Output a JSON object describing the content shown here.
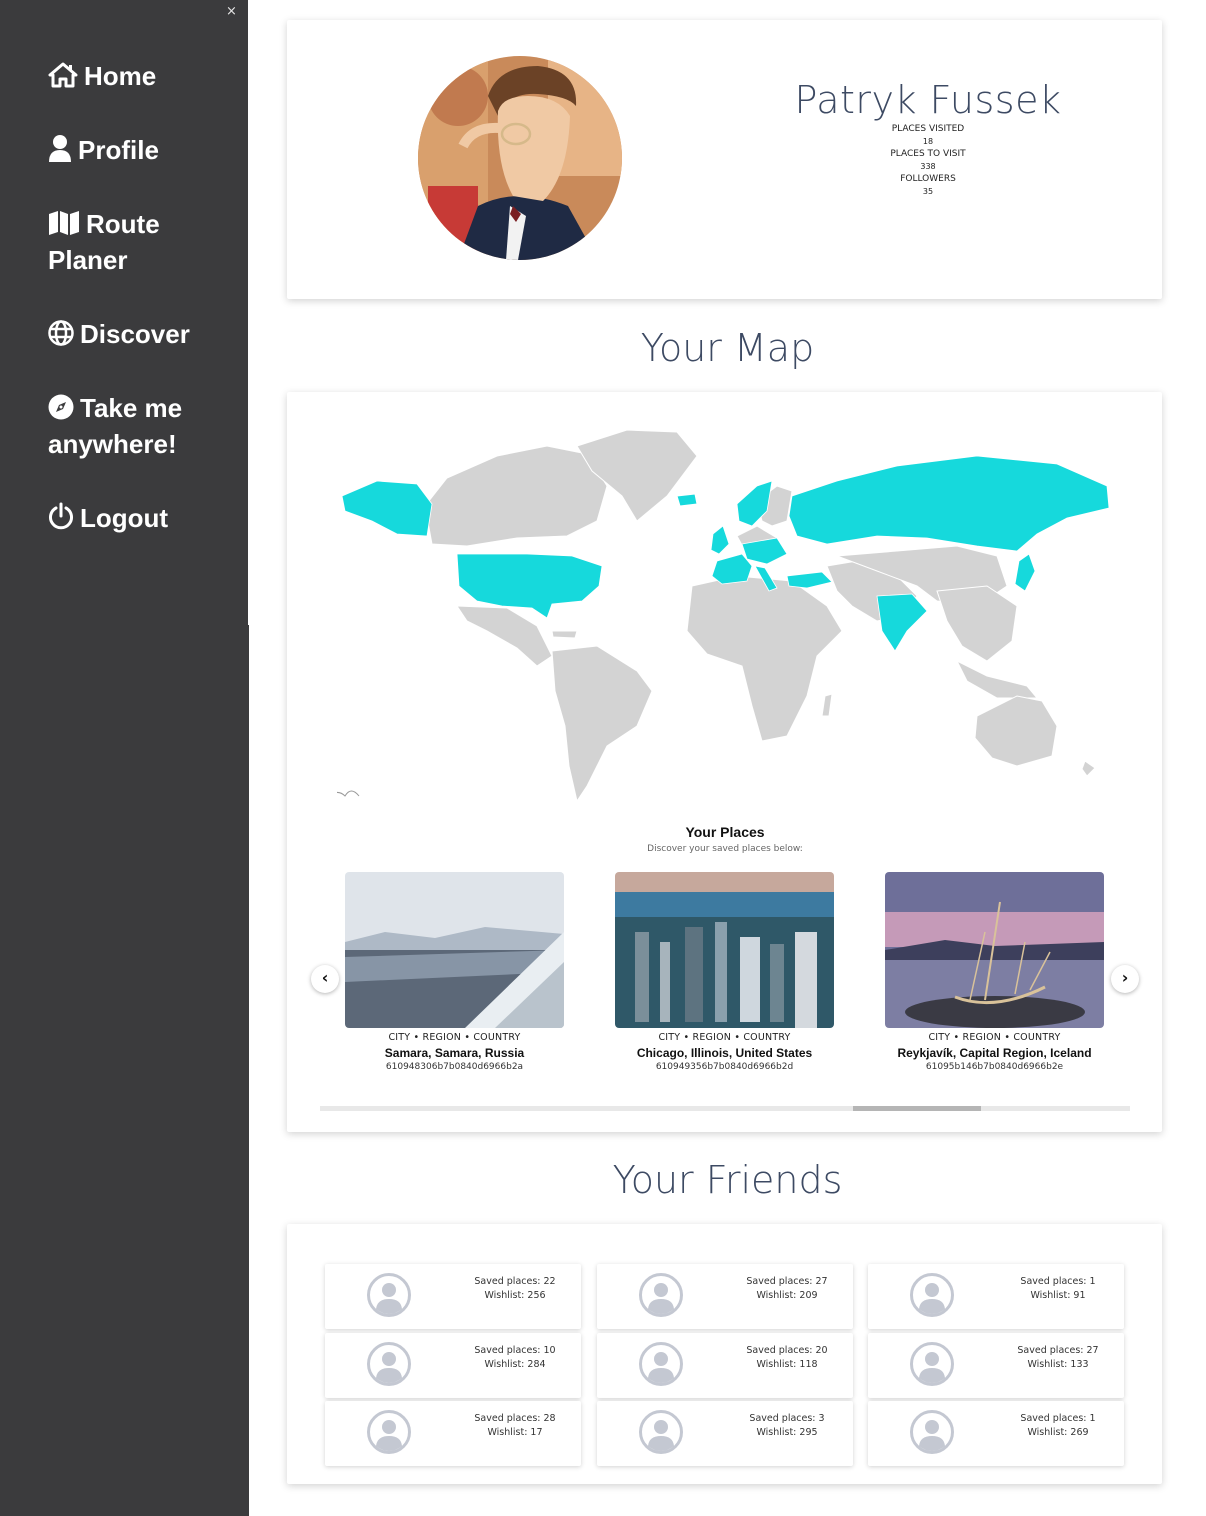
{
  "sidebar": {
    "close_label": "×",
    "items": [
      {
        "label": "Home",
        "icon": "home-icon"
      },
      {
        "label": "Profile",
        "icon": "user-icon"
      },
      {
        "label": "Route Planer",
        "icon": "map-icon"
      },
      {
        "label": "Discover",
        "icon": "globe-icon"
      },
      {
        "label": "Take me anywhere!",
        "icon": "compass-icon"
      },
      {
        "label": "Logout",
        "icon": "power-icon"
      }
    ]
  },
  "profile": {
    "name": "Patryk Fussek",
    "stats": [
      {
        "label": "PLACES VISITED",
        "value": "18"
      },
      {
        "label": "PLACES TO VISIT",
        "value": "338"
      },
      {
        "label": "FOLLOWERS",
        "value": "35"
      }
    ]
  },
  "map_section": {
    "title": "Your Map",
    "visited_color": "#16d9dc",
    "other_color": "#d3d3d3",
    "visited_regions": [
      "Alaska",
      "United States",
      "United Kingdom",
      "France",
      "Spain",
      "Portugal",
      "Italy",
      "Germany",
      "Poland",
      "Scandinavia",
      "Turkey",
      "Russia",
      "India",
      "Japan"
    ]
  },
  "places": {
    "title": "Your Places",
    "subtitle": "Discover your saved places below:",
    "items": [
      {
        "meta": "CITY • REGION • COUNTRY",
        "name": "Samara, Samara, Russia",
        "id": "610948306b7b0840d6966b2a"
      },
      {
        "meta": "CITY • REGION • COUNTRY",
        "name": "Chicago, Illinois, United States",
        "id": "610949356b7b0840d6966b2d"
      },
      {
        "meta": "CITY • REGION • COUNTRY",
        "name": "Reykjavík, Capital Region, Iceland",
        "id": "61095b146b7b0840d6966b2e"
      }
    ],
    "prev_label": "‹",
    "next_label": "›"
  },
  "friends_section": {
    "title": "Your Friends",
    "items": [
      {
        "saved": "Saved places: 22",
        "wishlist": "Wishlist: 256"
      },
      {
        "saved": "Saved places: 27",
        "wishlist": "Wishlist: 209"
      },
      {
        "saved": "Saved places: 1",
        "wishlist": "Wishlist: 91"
      },
      {
        "saved": "Saved places: 10",
        "wishlist": "Wishlist: 284"
      },
      {
        "saved": "Saved places: 20",
        "wishlist": "Wishlist: 118"
      },
      {
        "saved": "Saved places: 27",
        "wishlist": "Wishlist: 133"
      },
      {
        "saved": "Saved places: 28",
        "wishlist": "Wishlist: 17"
      },
      {
        "saved": "Saved places: 3",
        "wishlist": "Wishlist: 295"
      },
      {
        "saved": "Saved places: 1",
        "wishlist": "Wishlist: 269"
      }
    ]
  }
}
